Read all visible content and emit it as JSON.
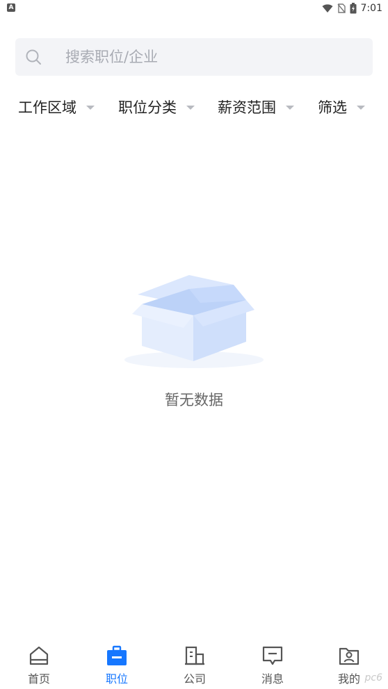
{
  "status_bar": {
    "time": "7:01",
    "left_icon": "A"
  },
  "search": {
    "placeholder": "搜索职位/企业"
  },
  "filters": [
    {
      "label": "工作区域"
    },
    {
      "label": "职位分类"
    },
    {
      "label": "薪资范围"
    },
    {
      "label": "筛选"
    }
  ],
  "empty_state": {
    "text": "暂无数据",
    "icon": "empty-box-icon"
  },
  "bottom_nav": {
    "active_index": 1,
    "accent_color": "#1677ff",
    "items": [
      {
        "label": "首页",
        "icon": "home-icon"
      },
      {
        "label": "职位",
        "icon": "briefcase-icon"
      },
      {
        "label": "公司",
        "icon": "building-icon"
      },
      {
        "label": "消息",
        "icon": "message-icon"
      },
      {
        "label": "我的",
        "icon": "profile-icon"
      }
    ]
  },
  "watermark": "pc6"
}
